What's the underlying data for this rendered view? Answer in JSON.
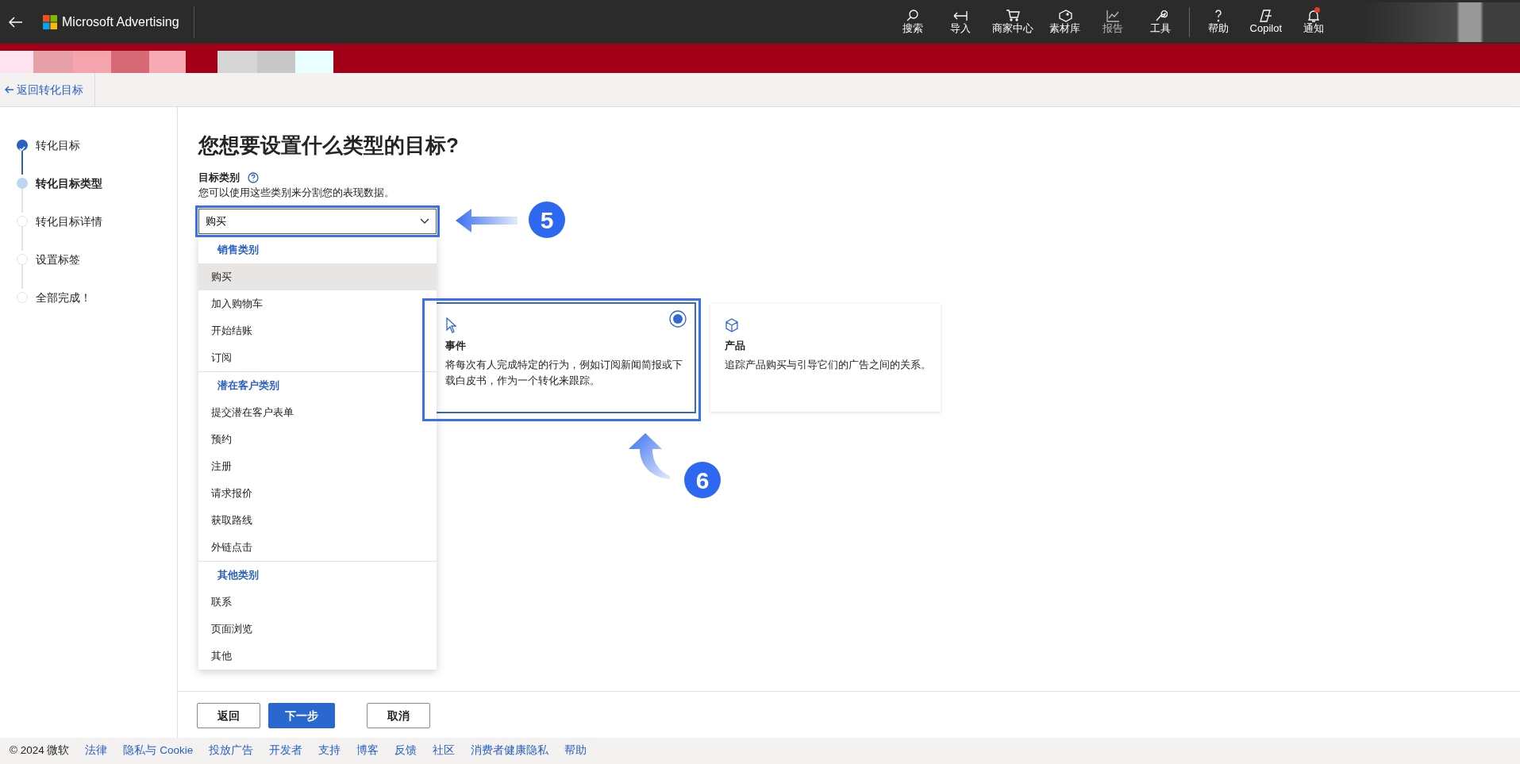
{
  "topbar": {
    "app_name": "Microsoft Advertising",
    "nav": [
      {
        "label": "搜索",
        "disabled": false,
        "alert": false
      },
      {
        "label": "导入",
        "disabled": false,
        "alert": false
      },
      {
        "label": "商家中心",
        "disabled": false,
        "alert": false
      },
      {
        "label": "素材库",
        "disabled": false,
        "alert": false
      },
      {
        "label": "报告",
        "disabled": true,
        "alert": false
      },
      {
        "label": "工具",
        "disabled": false,
        "alert": false
      },
      {
        "label": "帮助",
        "disabled": false,
        "alert": false
      },
      {
        "label": "Copilot",
        "disabled": false,
        "alert": false
      },
      {
        "label": "通知",
        "disabled": false,
        "alert": true
      }
    ]
  },
  "back_link": "返回转化目标",
  "steps": [
    {
      "label": "转化目标",
      "completed": true,
      "selected": false
    },
    {
      "label": "转化目标类型",
      "completed": false,
      "selected": true
    },
    {
      "label": "转化目标详情",
      "completed": false,
      "selected": false
    },
    {
      "label": "设置标签",
      "completed": false,
      "selected": false
    },
    {
      "label": "全部完成！",
      "completed": false,
      "selected": false
    }
  ],
  "page": {
    "title": "您想要设置什么类型的目标?",
    "field_label": "目标类别",
    "field_help": "您可以使用这些类别来分割您的表现数据。",
    "select": {
      "value": "购买"
    },
    "dropdown": {
      "groups": [
        {
          "header": "销售类别",
          "items": [
            {
              "label": "购买",
              "selected": true
            },
            {
              "label": "加入购物车",
              "selected": false
            },
            {
              "label": "开始结账",
              "selected": false
            },
            {
              "label": "订阅",
              "selected": false
            }
          ]
        },
        {
          "header": "潜在客户类别",
          "items": [
            {
              "label": "提交潜在客户表单",
              "selected": false
            },
            {
              "label": "预约",
              "selected": false
            },
            {
              "label": "注册",
              "selected": false
            },
            {
              "label": "请求报价",
              "selected": false
            },
            {
              "label": "获取路线",
              "selected": false
            },
            {
              "label": "外链点击",
              "selected": false
            }
          ]
        },
        {
          "header": "其他类别",
          "items": [
            {
              "label": "联系",
              "selected": false
            },
            {
              "label": "页面浏览",
              "selected": false
            },
            {
              "label": "其他",
              "selected": false
            }
          ]
        }
      ]
    },
    "cards": [
      {
        "title": "事件",
        "description": "将每次有人完成特定的行为，例如订阅新闻简报或下载白皮书，作为一个转化来跟踪。",
        "selected": true
      },
      {
        "title": "产品",
        "description": "追踪产品购买与引导它们的广告之间的关系。",
        "selected": false
      }
    ]
  },
  "annotations": [
    {
      "number": "5"
    },
    {
      "number": "6"
    }
  ],
  "buttons": [
    {
      "label": "返回",
      "kind": "secondary"
    },
    {
      "label": "下一步",
      "kind": "primary"
    },
    {
      "label": "取消",
      "kind": "secondary"
    }
  ],
  "footer": {
    "copyright": "© 2024 微软",
    "links": [
      "法律",
      "隐私与 Cookie",
      "投放广告",
      "开发者",
      "支持",
      "博客",
      "反馈",
      "社区",
      "消费者健康隐私",
      "帮助"
    ]
  }
}
